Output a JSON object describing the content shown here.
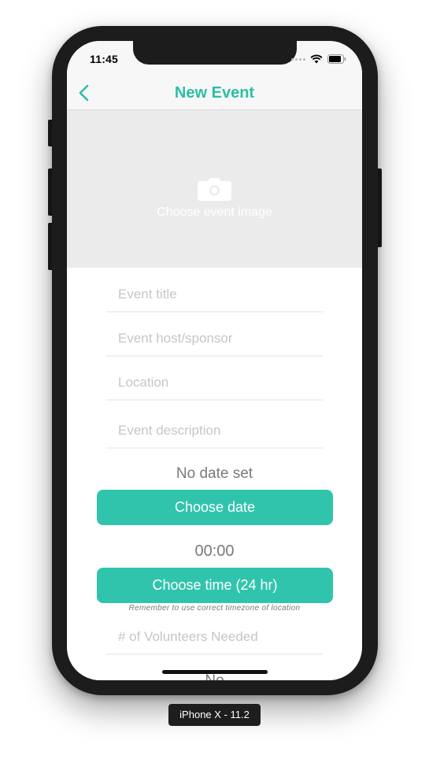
{
  "status_bar": {
    "time": "11:45"
  },
  "nav": {
    "title": "New Event",
    "back_icon": "chevron-left-icon"
  },
  "image_chooser": {
    "icon": "camera-icon",
    "label": "Choose event image"
  },
  "form": {
    "title_placeholder": "Event title",
    "host_placeholder": "Event host/sponsor",
    "location_placeholder": "Location",
    "description_placeholder": "Event description",
    "date_value": "No date set",
    "choose_date_label": "Choose date",
    "time_value": "00:00",
    "choose_time_label": "Choose time (24 hr)",
    "timezone_note": "Remember to use correct timezone of location",
    "volunteers_placeholder": "# of Volunteers Needed",
    "partial_text": "No"
  },
  "device_label": "iPhone X - 11.2",
  "colors": {
    "accent": "#31c4ad",
    "nav_title": "#2bbfa8",
    "image_area": "#ebebeb",
    "placeholder": "#c6c6c6"
  }
}
